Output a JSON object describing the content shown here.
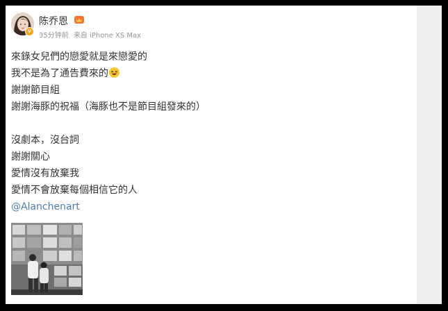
{
  "post": {
    "author": "陈乔恩",
    "time": "35分钟前",
    "source": "来自 iPhone XS Max",
    "lines": [
      "來錄女兒們的戀愛就是來戀愛的",
      "我不是為了通告費來的",
      "謝謝節目組",
      "謝謝海豚的祝福（海豚也不是節目組發來的）",
      "",
      "沒劇本，沒台詞",
      "謝謝關心",
      "愛情沒有放棄我",
      "愛情不會放棄每個相信它的人"
    ],
    "mention": "@Alanchenart",
    "emoji": "laughing-face-emoji",
    "image_alt": "black-and-white photo of two people viewing framed photographs on a gallery wall"
  },
  "colors": {
    "mention": "#507daf",
    "meta_text": "#939393",
    "body_text": "#333333",
    "verified_badge": "#f5a623",
    "outer_frame": "#000000",
    "right_gutter": "#efefef"
  }
}
